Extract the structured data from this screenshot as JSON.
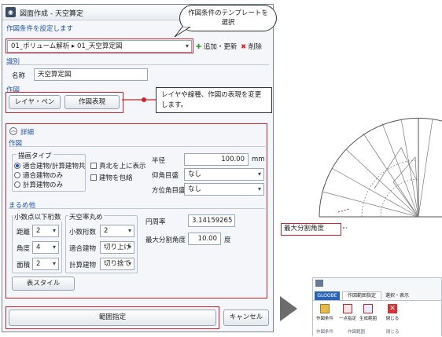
{
  "window": {
    "title": "図面作成 - 天空算定"
  },
  "template_section": {
    "label": "作図条件を設定します",
    "value": "01_ボリューム解析 ▸ 01_天空算定図",
    "add_label": "追加・更新",
    "delete_label": "削除"
  },
  "identity": {
    "section": "識別",
    "name_label": "名称",
    "name_value": "天空算定図"
  },
  "drawing": {
    "section": "作図",
    "layer_button": "レイヤ・ペン",
    "expression_button": "作図表現"
  },
  "details": {
    "header": "詳細",
    "sub_section": "作図",
    "drawing_type": {
      "label": "描画タイプ",
      "options": [
        "適合建物/計算建物共",
        "適合建物のみ",
        "計算建物のみ"
      ],
      "selected": 0
    },
    "true_north_label": "真北を上に表示",
    "include_building_label": "建物を包絡",
    "radius_label": "半径",
    "radius_value": "100.00",
    "radius_unit": "mm",
    "elev_label": "仰角目盛",
    "elev_value": "なし",
    "azim_label": "方位角目盛",
    "azim_value": "なし",
    "rounding_section": "まるめ他",
    "decimal_group": "小数点以下桁数",
    "distance_label": "距離",
    "distance_value": "2",
    "angle_label": "角度",
    "angle_value": "4",
    "area_label": "面積",
    "area_value": "2",
    "skyratio_group": "天空率丸め",
    "sky_decimal_label": "小数桁数",
    "sky_decimal_value": "2",
    "fit_label": "適合建物",
    "fit_value": "切り上げ",
    "calc_label": "計算建物",
    "calc_value": "切り捨て",
    "pi_label": "円周率",
    "pi_value": "3.14159265",
    "maxangle_label": "最大分割角度",
    "maxangle_value": "10.00",
    "maxangle_unit": "度",
    "table_style_button": "表スタイル"
  },
  "footer": {
    "ok_button": "範囲指定",
    "cancel_button": "キャンセル"
  },
  "callouts": {
    "template": "作図条件のテンプレートを選択",
    "layer": "レイヤや線種、作図の表現を変更します。",
    "max_angle": "最大分割角度"
  },
  "ribbon": {
    "app_tab": "GLOOBE",
    "tabs": [
      "作図範囲指定",
      "選択・表示"
    ],
    "buttons": [
      "作図条件",
      "一点指定",
      "生成範囲",
      "閉じる"
    ],
    "groups": [
      "作図条件",
      "作図範囲",
      "閉じる"
    ]
  },
  "colors": {
    "highlight": "#c8262c",
    "accent": "#2356a8"
  }
}
